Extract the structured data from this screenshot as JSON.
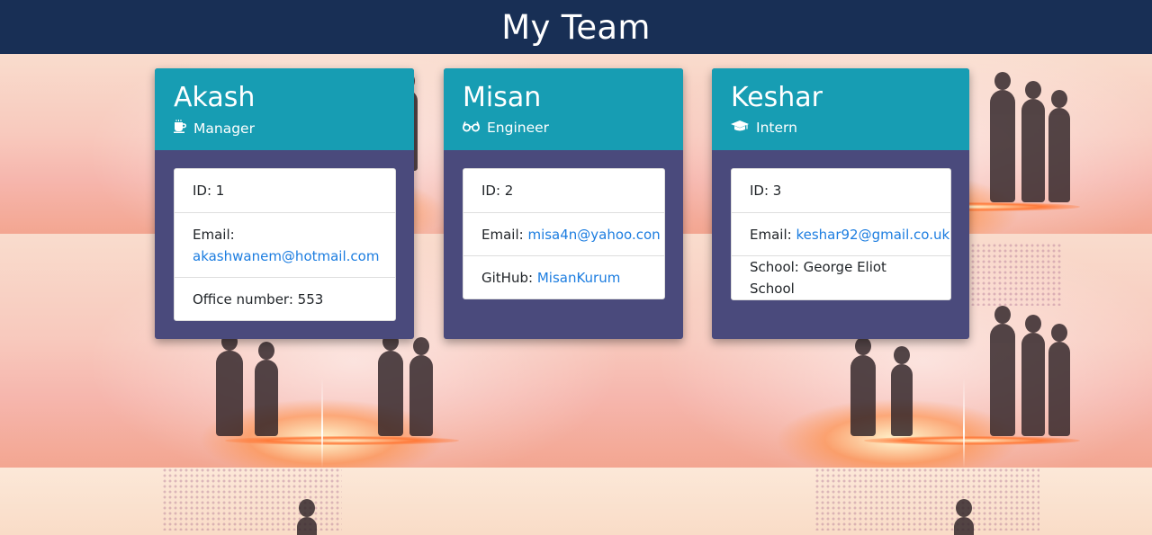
{
  "header": {
    "title": "My Team"
  },
  "colors": {
    "header_bg": "#182f55",
    "card_head_bg": "#179db3",
    "card_body_bg": "#4a4a7c",
    "link": "#1c7de0"
  },
  "cards": [
    {
      "name": "Akash",
      "role": "Manager",
      "role_icon": "coffee-mug-icon",
      "id_label": "ID: 1",
      "email_prefix": "Email:",
      "email": "akashwanem@hotmail.com",
      "extra_label": "Office number: 553"
    },
    {
      "name": "Misan",
      "role": "Engineer",
      "role_icon": "glasses-icon",
      "id_label": "ID: 2",
      "email_prefix": "Email:",
      "email": "misa4n@yahoo.con",
      "extra_prefix": "GitHub:",
      "extra_link": "MisanKurum"
    },
    {
      "name": "Keshar",
      "role": "Intern",
      "role_icon": "graduation-cap-icon",
      "id_label": "ID: 3",
      "email_prefix": "Email:",
      "email": "keshar92@gmail.co.uk",
      "extra_label": "School: George Eliot School"
    }
  ]
}
